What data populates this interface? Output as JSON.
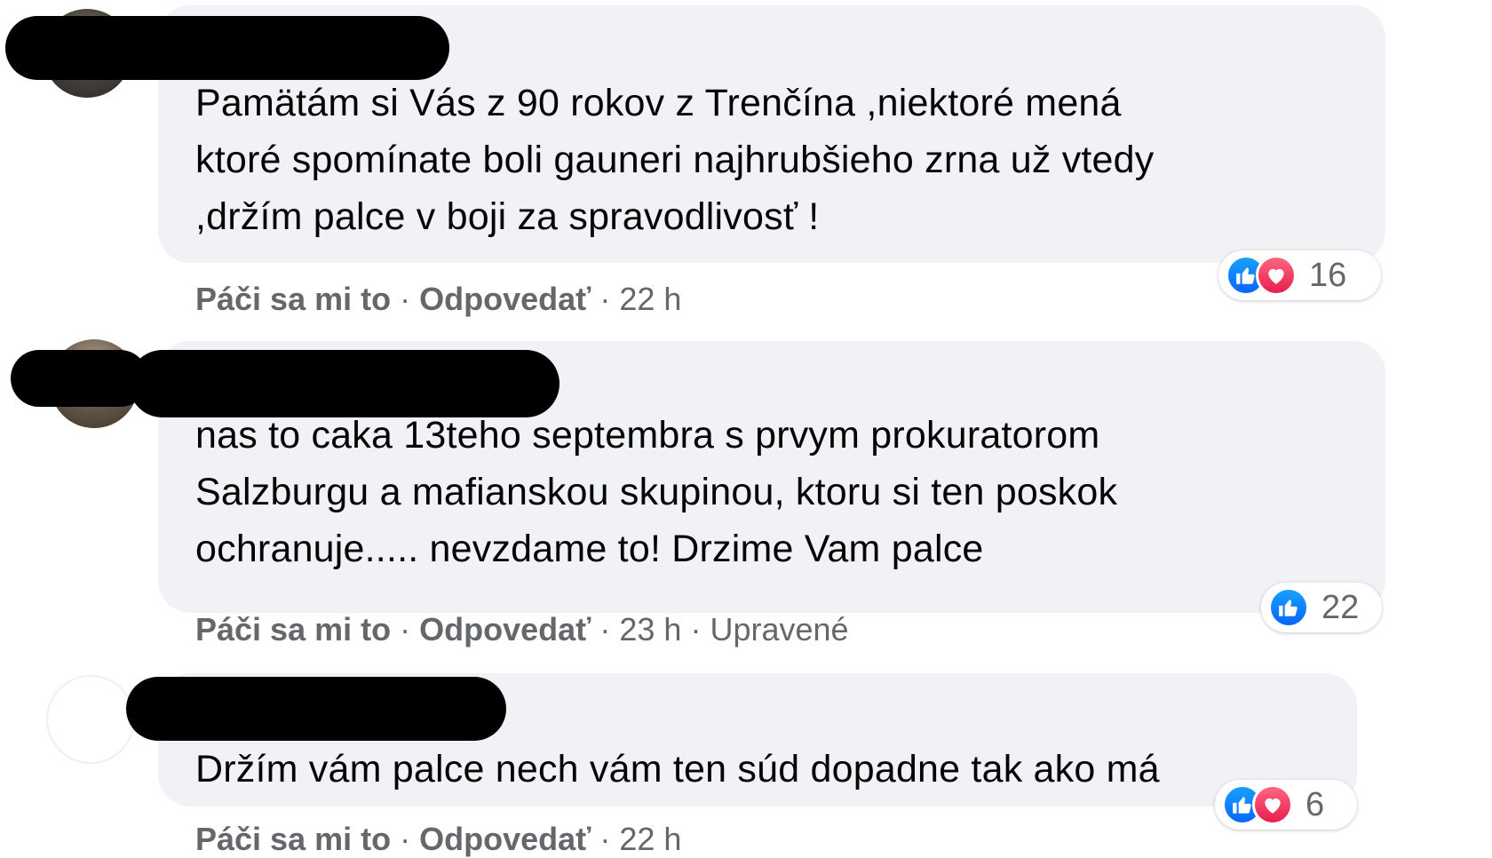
{
  "comments": [
    {
      "text": "Pamätám si Vás z 90 rokov z Trenčína ,niektoré mená\nktoré spomínate boli gauneri najhrubšieho zrna už vtedy\n,držím palce v boji za spravodlivosť !",
      "like_label": "Páči sa mi to",
      "reply_label": "Odpovedať",
      "time": "22 h",
      "reaction_count": "16",
      "reactions": [
        "like-icon",
        "love-icon"
      ]
    },
    {
      "text": "nas to caka 13teho septembra s prvym prokuratorom\nSalzburgu a mafianskou skupinou, ktoru si ten poskok\nochranuje..... nevzdame to! Drzime Vam palce",
      "like_label": "Páči sa mi to",
      "reply_label": "Odpovedať",
      "time": "23 h",
      "edited": "Upravené",
      "reaction_count": "22",
      "reactions": [
        "like-icon"
      ]
    },
    {
      "text": "Držím vám palce nech vám ten súd dopadne tak ako má",
      "like_label": "Páči sa mi to",
      "reply_label": "Odpovedať",
      "time": "22 h",
      "reaction_count": "6",
      "reactions": [
        "like-icon",
        "love-icon"
      ]
    }
  ],
  "separator": "·",
  "colors": {
    "bubble": "#f0f2f5",
    "meta_text": "#65676b",
    "like": "#0866ff",
    "love": "#f33e58",
    "redaction": "#000000"
  }
}
